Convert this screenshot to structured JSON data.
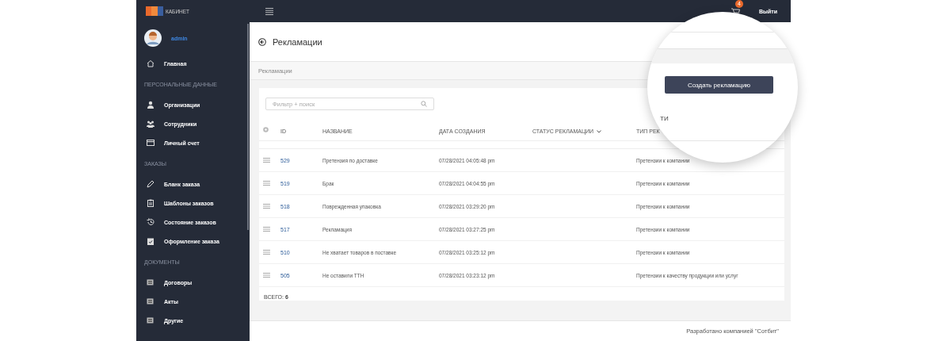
{
  "topbar": {
    "logo_caption": "КАБИНЕТ",
    "cart_badge": "4",
    "logout": "Выйти"
  },
  "sidebar": {
    "user": "admin",
    "items": [
      {
        "kind": "item",
        "label": "Главная",
        "selected": false
      },
      {
        "kind": "heading",
        "label": "ПЕРСОНАЛЬНЫЕ ДАННЫЕ"
      },
      {
        "kind": "item",
        "label": "Организации",
        "selected": false
      },
      {
        "kind": "item",
        "label": "Сотрудники",
        "selected": false
      },
      {
        "kind": "item",
        "label": "Личный счет",
        "selected": false
      },
      {
        "kind": "heading",
        "label": "ЗАКАЗЫ"
      },
      {
        "kind": "item",
        "label": "Бланк заказа",
        "selected": false
      },
      {
        "kind": "item",
        "label": "Шаблоны заказов",
        "selected": false
      },
      {
        "kind": "item",
        "label": "Состояние заказов",
        "selected": false
      },
      {
        "kind": "item",
        "label": "Оформление заказа",
        "selected": false
      },
      {
        "kind": "heading",
        "label": "ДОКУМЕНТЫ"
      },
      {
        "kind": "item",
        "label": "Договоры",
        "selected": false
      },
      {
        "kind": "item",
        "label": "Акты",
        "selected": false
      },
      {
        "kind": "item",
        "label": "Другие",
        "selected": false
      }
    ]
  },
  "page": {
    "title": "Рекламации",
    "breadcrumb": "Рекламации"
  },
  "table": {
    "search": {
      "placeholder": "Фильтр + поиск"
    },
    "columns": [
      {
        "label": "ID",
        "sorted": false
      },
      {
        "label": "НАЗВАНИЕ",
        "sorted": false
      },
      {
        "label": "ДАТА СОЗДАНИЯ",
        "sorted": false
      },
      {
        "label": "СТАТУС РЕКЛАМАЦИИ",
        "sorted": true
      },
      {
        "label": "ТИП РЕК",
        "sorted": false
      }
    ],
    "rows": [
      {
        "id": "529",
        "name": "Претензия по доставке",
        "date": "07/28/2021 04:05:48 pm",
        "type": "Претензии к компании"
      },
      {
        "id": "519",
        "name": "Брак",
        "date": "07/28/2021 04:04:55 pm",
        "type": "Претензии к компании"
      },
      {
        "id": "518",
        "name": "Поврежденная упаковка",
        "date": "07/28/2021 03:29:20 pm",
        "type": "Претензии к компании"
      },
      {
        "id": "517",
        "name": "Рекламация",
        "date": "07/28/2021 03:27:25 pm",
        "type": "Претензии к компании"
      },
      {
        "id": "510",
        "name": "Не хватает товаров в поставке",
        "date": "07/28/2021 03:25:12 pm",
        "type": "Претензии к компании"
      },
      {
        "id": "505",
        "name": "Не оставили ТТН",
        "date": "07/28/2021 03:23:12 pm",
        "type": "Претензии к качеству продукции или услуг"
      }
    ],
    "total": "ВСЕГО: **6**"
  },
  "magnifier": {
    "button": "Создать рекламацию",
    "fragment": "ТИ"
  },
  "footer": "Разработано компанией \"Сотбит\""
}
